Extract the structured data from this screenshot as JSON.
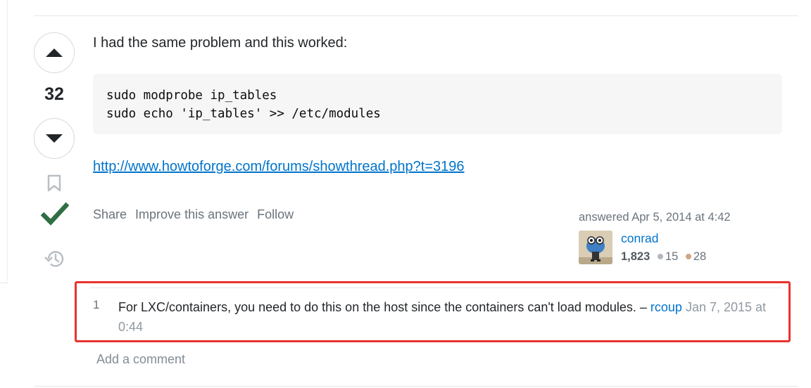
{
  "vote": {
    "count": "32"
  },
  "icons": {
    "up": "triangle-up-icon",
    "down": "triangle-down-icon",
    "bookmark": "bookmark-icon",
    "accepted": "checkmark-icon",
    "history": "history-icon"
  },
  "post": {
    "text": "I had the same problem and this worked:",
    "code": "sudo modprobe ip_tables\nsudo echo 'ip_tables' >> /etc/modules",
    "link": "http://www.howtoforge.com/forums/showthread.php?t=3196"
  },
  "menu": {
    "share": "Share",
    "improve": "Improve this answer",
    "follow": "Follow"
  },
  "user": {
    "action_time": "answered Apr 5, 2014 at 4:42",
    "name": "conrad",
    "reputation": "1,823",
    "silver": "15",
    "bronze": "28"
  },
  "comment": {
    "score": "1",
    "text": "For LXC/containers, you need to do this on the host since the containers can't load modules. – ",
    "user": "rcoup",
    "date": "Jan 7, 2015 at 0:44"
  },
  "add_comment": "Add a comment",
  "colors": {
    "accent": "#0074cc",
    "accepted": "#2f6f44",
    "highlight": "#e8332e"
  }
}
